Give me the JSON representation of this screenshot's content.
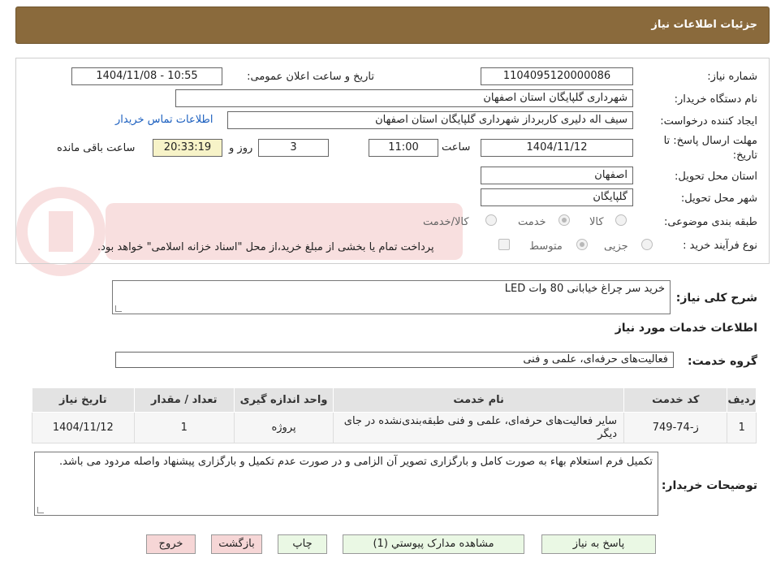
{
  "header": {
    "title": "جزئیات اطلاعات نیاز"
  },
  "form": {
    "need_number_label": "شماره نیاز:",
    "need_number": "1104095120000086",
    "announce_label": "تاریخ و ساعت اعلان عمومی:",
    "announce_value": "1404/11/08 - 10:55",
    "buyer_org_label": "نام دستگاه خریدار:",
    "buyer_org": "شهرداری گلپایگان استان اصفهان",
    "creator_label": "ایجاد کننده درخواست:",
    "creator": "سیف اله دلیری کاربرداز شهرداری گلپایگان استان اصفهان",
    "contact_link": "اطلاعات تماس خریدار",
    "deadline_label_1": "مهلت ارسال پاسخ: تا",
    "deadline_label_2": "تاریخ:",
    "deadline_date": "1404/11/12",
    "time_label": "ساعت",
    "deadline_time": "11:00",
    "days_value": "3",
    "days_label": "روز و",
    "remaining_time": "20:33:19",
    "remaining_label": "ساعت باقی مانده",
    "province_label": "استان محل تحویل:",
    "province": "اصفهان",
    "city_label": "شهر محل تحویل:",
    "city": "گلپایگان",
    "category_label": "طبقه بندی موضوعی:",
    "category_options": [
      "کالا",
      "خدمت",
      "کالا/خدمت"
    ],
    "category_selected": "خدمت",
    "process_label": "نوع فرآیند خرید :",
    "process_options": [
      "جزیی",
      "متوسط"
    ],
    "process_selected": "متوسط",
    "payment_note": "پرداخت تمام یا بخشی از مبلغ خرید،از محل \"اسناد خزانه اسلامی\" خواهد بود."
  },
  "summary": {
    "label": "شرح کلی نیاز:",
    "value": "خرید سر چراغ خیابانی 80 وات LED"
  },
  "services": {
    "section_title": "اطلاعات خدمات مورد نیاز",
    "group_label": "گروه خدمت:",
    "group_value": "فعالیت‌های حرفه‌ای، علمی و فنی",
    "columns": [
      "ردیف",
      "کد خدمت",
      "نام خدمت",
      "واحد اندازه گیری",
      "تعداد / مقدار",
      "تاریخ نیاز"
    ],
    "rows": [
      [
        "1",
        "ز-74-749",
        "سایر فعالیت‌های حرفه‌ای، علمی و فنی طبقه‌بندی‌نشده در جای دیگر",
        "پروژه",
        "1",
        "1404/11/12"
      ]
    ]
  },
  "buyer_notes": {
    "label": "توضیحات خریدار:",
    "value": "تکمیل فرم استعلام بهاء به صورت کامل و بارگزاری تصویر آن الزامی و در صورت عدم تکمیل و بارگزاری پیشنهاد واصله مردود می باشد."
  },
  "buttons": {
    "reply": "پاسخ به نیاز",
    "attachments": "مشاهده مدارک پیوستي (1)",
    "print": "چاپ",
    "back": "بازگشت",
    "exit": "خروج"
  },
  "colors": {
    "header_bg": "#8a6a3c",
    "button_green": "#eaf8e4",
    "button_pink": "#f6d6d6",
    "time_highlight": "#f7f3c8",
    "link": "#1b5fbf"
  },
  "icons": {
    "watermark": "aria-tender-logo-watermark"
  }
}
